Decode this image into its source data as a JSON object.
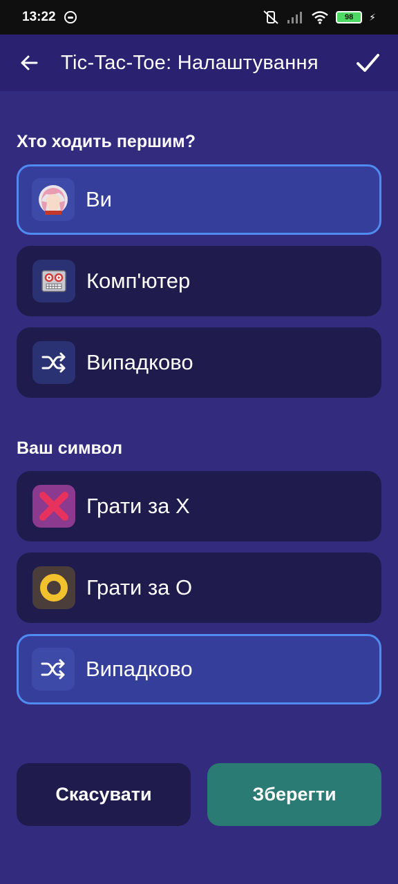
{
  "status_bar": {
    "time": "13:22",
    "battery": "98"
  },
  "app_bar": {
    "title": "Tic-Tac-Toe: Налаштування"
  },
  "first_move": {
    "heading": "Хто ходить першим?",
    "options": [
      {
        "label": "Ви",
        "icon": "avatar-icon",
        "selected": true
      },
      {
        "label": "Комп'ютер",
        "icon": "robot-icon",
        "selected": false
      },
      {
        "label": "Випадково",
        "icon": "shuffle-icon",
        "selected": false
      }
    ]
  },
  "symbol": {
    "heading": "Ваш символ",
    "options": [
      {
        "label": "Грати за X",
        "icon": "x-mark-icon",
        "selected": false
      },
      {
        "label": "Грати за O",
        "icon": "o-mark-icon",
        "selected": false
      },
      {
        "label": "Випадково",
        "icon": "shuffle-icon",
        "selected": true
      }
    ]
  },
  "actions": {
    "cancel": "Скасувати",
    "save": "Зберегти"
  },
  "colors": {
    "background": "#332c7e",
    "app_bar": "#2a2170",
    "card": "#1f1b4d",
    "card_selected": "#353f9b",
    "selected_border": "#4f8bf0",
    "save_button": "#2a7b73",
    "x_mark": "#e8325e",
    "o_mark": "#f2c12e"
  }
}
